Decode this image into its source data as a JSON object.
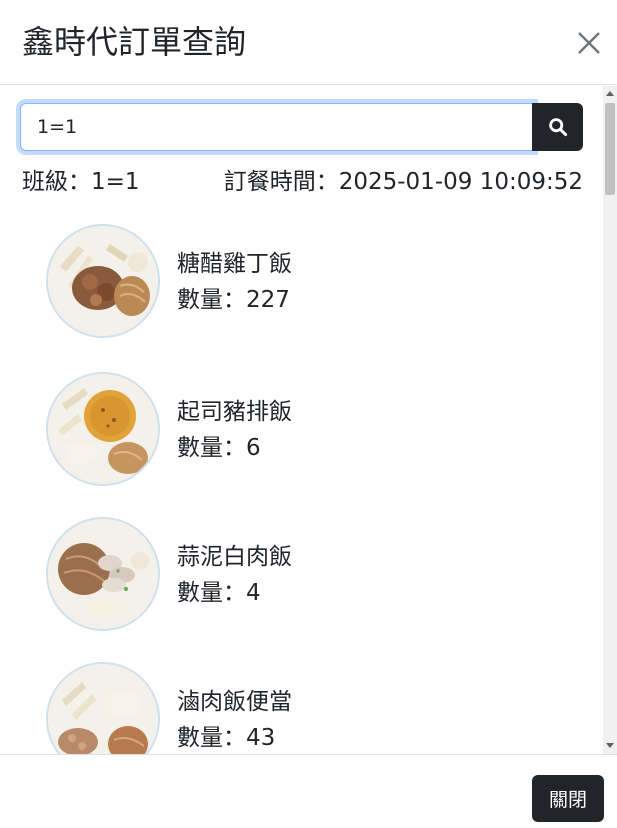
{
  "modal": {
    "title": "鑫時代訂單查詢",
    "close_label": "關閉"
  },
  "search": {
    "value": "1=1"
  },
  "meta": {
    "class_text": "班級：1=1",
    "time_text": "訂餐時間：2025-01-09 10:09:52"
  },
  "items": [
    {
      "name": "糖醋雞丁飯",
      "qty": "數量：227"
    },
    {
      "name": "起司豬排飯",
      "qty": "數量：6"
    },
    {
      "name": "蒜泥白肉飯",
      "qty": "數量：4"
    },
    {
      "name": "滷肉飯便當",
      "qty": "數量：43"
    }
  ],
  "icons": {
    "close": "close-icon",
    "search": "search-icon"
  },
  "colors": {
    "dark_button": "#212529",
    "focus_border": "#86b7fe"
  }
}
